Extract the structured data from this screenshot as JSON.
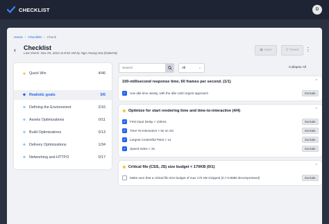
{
  "app": {
    "title": "CHECKLIST",
    "avatar_initial": "D"
  },
  "breadcrumb": [
    "Home",
    "Checklist",
    "Check"
  ],
  "page": {
    "back": "‹",
    "title": "Checklist",
    "subtitle": "Last check: Nov 25, 2022 at 8:52 AM by Ngo Hoang Dat (DatNH5)"
  },
  "actions": {
    "save": "Save",
    "reset": "Reset",
    "more": "⋮"
  },
  "sidebar": {
    "items": [
      {
        "icon": "star-icon",
        "label": "Quick Win",
        "count": "4/46"
      },
      {
        "icon": "tag-icon",
        "label": "Realistic goals",
        "count": "5/6",
        "active": true
      },
      {
        "icon": "tag-icon",
        "label": "Defining the Environment",
        "count": "2/16"
      },
      {
        "icon": "tag-icon",
        "label": "Assets Optimizations",
        "count": "0/11"
      },
      {
        "icon": "tag-icon",
        "label": "Build Optimizations",
        "count": "0/13"
      },
      {
        "icon": "tag-icon",
        "label": "Delivery Optimizations",
        "count": "1/34"
      },
      {
        "icon": "tag-icon",
        "label": "Networking and HTTP/2",
        "count": "0/17"
      }
    ]
  },
  "toolbar": {
    "search_placeholder": "Search",
    "filter_value": "All",
    "collapse_label": "Collapse All"
  },
  "sections": [
    {
      "title": "100-millisecond response time, 60 frames per second. (1/1)",
      "starred": false,
      "items": [
        {
          "text": "Use idle time wisely, with the Idle Until Urgent approach",
          "checked": true,
          "action": "Exclude"
        }
      ]
    },
    {
      "title": "Optimize for start rendering time and time-to-interactive (4/4)",
      "starred": true,
      "items": [
        {
          "text": "First Input Delay < 100ms.",
          "checked": true,
          "action": "Exclude"
        },
        {
          "text": "Time-To-Interactive < 5s on 3G.",
          "checked": true,
          "action": "Exclude"
        },
        {
          "text": "Largest Contentful Paint < 1s",
          "checked": true,
          "action": "Exclude"
        },
        {
          "text": "Speed Index < 3s",
          "checked": true,
          "action": "Exclude"
        }
      ]
    },
    {
      "title": "Critical file (CSS, JS) size budget < 170KB (0/1)",
      "starred": true,
      "items": [
        {
          "text": "Make sure that a critical file size budget of max 170 KB Gzipped (0.7-0.8MB decompressed)",
          "checked": false,
          "action": "Exclude"
        }
      ]
    }
  ],
  "colors": {
    "accent": "#2563eb",
    "star": "#f5b400",
    "topbar": "#1e2433"
  }
}
